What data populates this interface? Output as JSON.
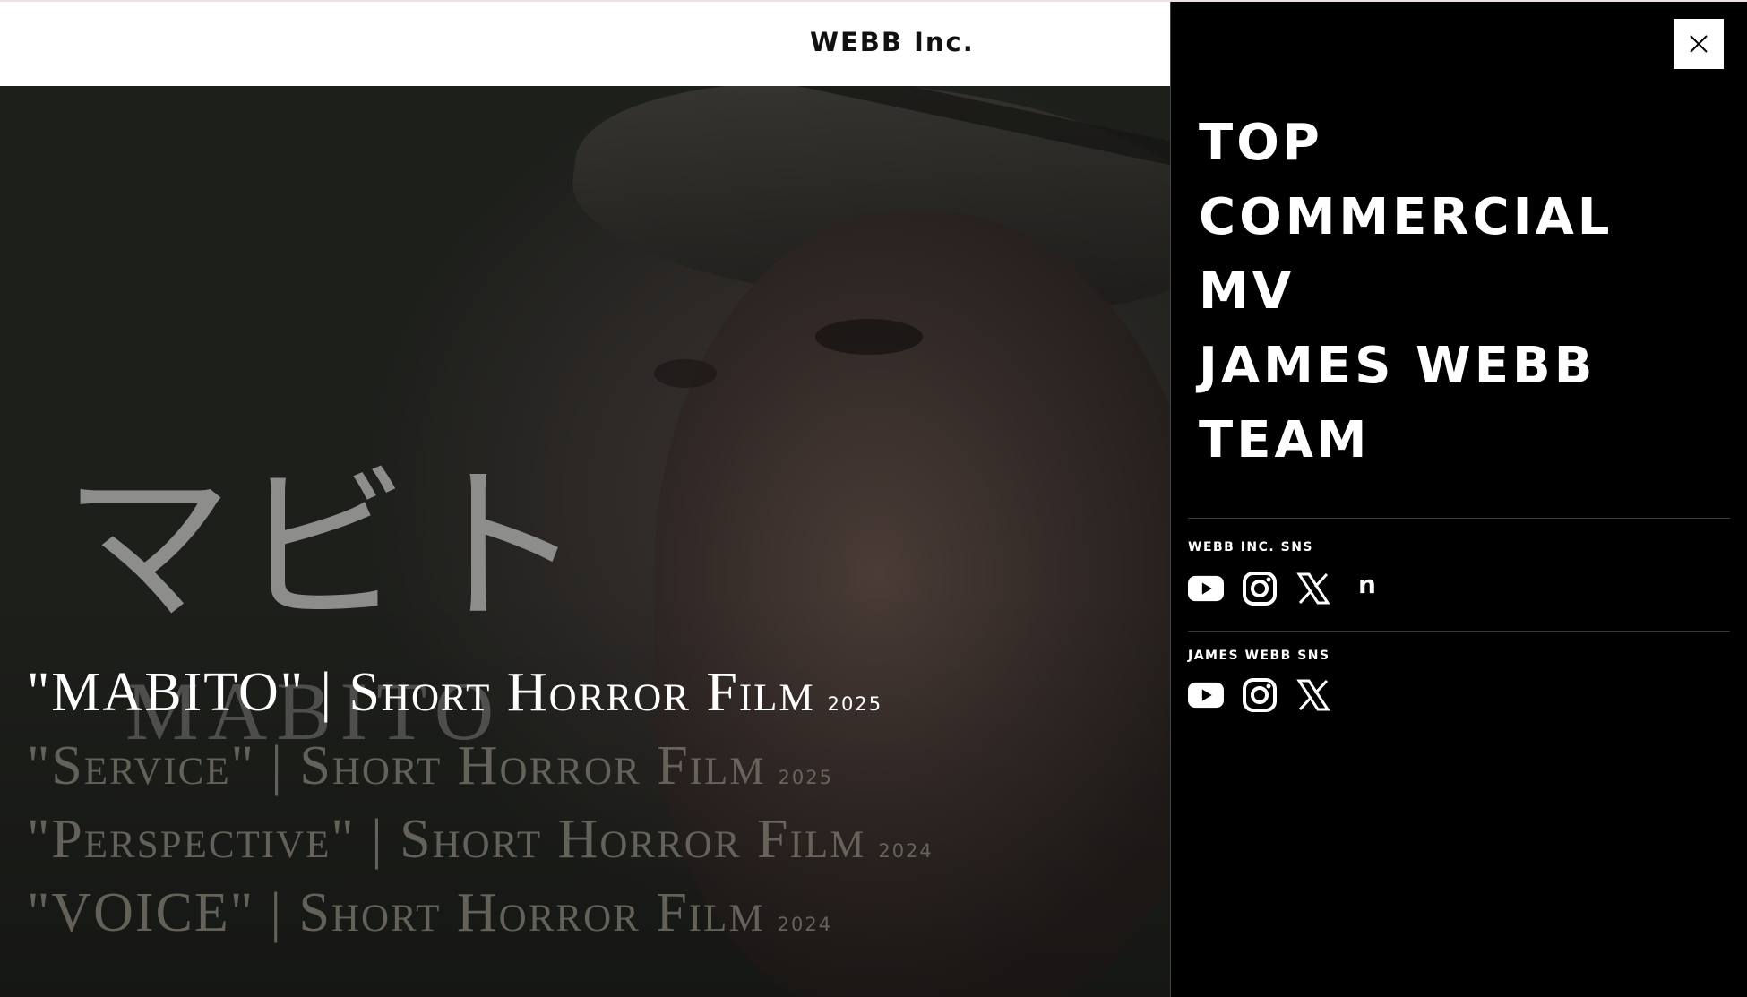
{
  "header": {
    "logo": "WEBB Inc."
  },
  "hero": {
    "jp_title": "マビト",
    "en_title": "MABITO",
    "films": [
      {
        "title": "\"MABITO\" | Short Horror Film",
        "year": "2025",
        "active": true
      },
      {
        "title": "\"Service\" | Short Horror Film",
        "year": "2025",
        "active": false
      },
      {
        "title": "\"Perspective\" | Short Horror Film",
        "year": "2024",
        "active": false
      },
      {
        "title": "\"VOICE\" | Short Horror Film",
        "year": "2024",
        "active": false
      }
    ]
  },
  "menu": {
    "nav": [
      "TOP",
      "COMMERCIAL",
      "MV",
      "JAMES WEBB",
      "TEAM"
    ],
    "sns_groups": [
      {
        "label": "WEBB INC. SNS",
        "icons": [
          "youtube-icon",
          "instagram-icon",
          "x-icon",
          "note-icon"
        ]
      },
      {
        "label": "JAMES WEBB SNS",
        "icons": [
          "youtube-icon",
          "instagram-icon",
          "x-icon"
        ]
      }
    ],
    "note_glyph": "n"
  },
  "colors": {
    "menu_bg": "#000000",
    "header_bg": "#ffffff",
    "active_text": "#ffffff",
    "dim_text": "#78766c"
  }
}
